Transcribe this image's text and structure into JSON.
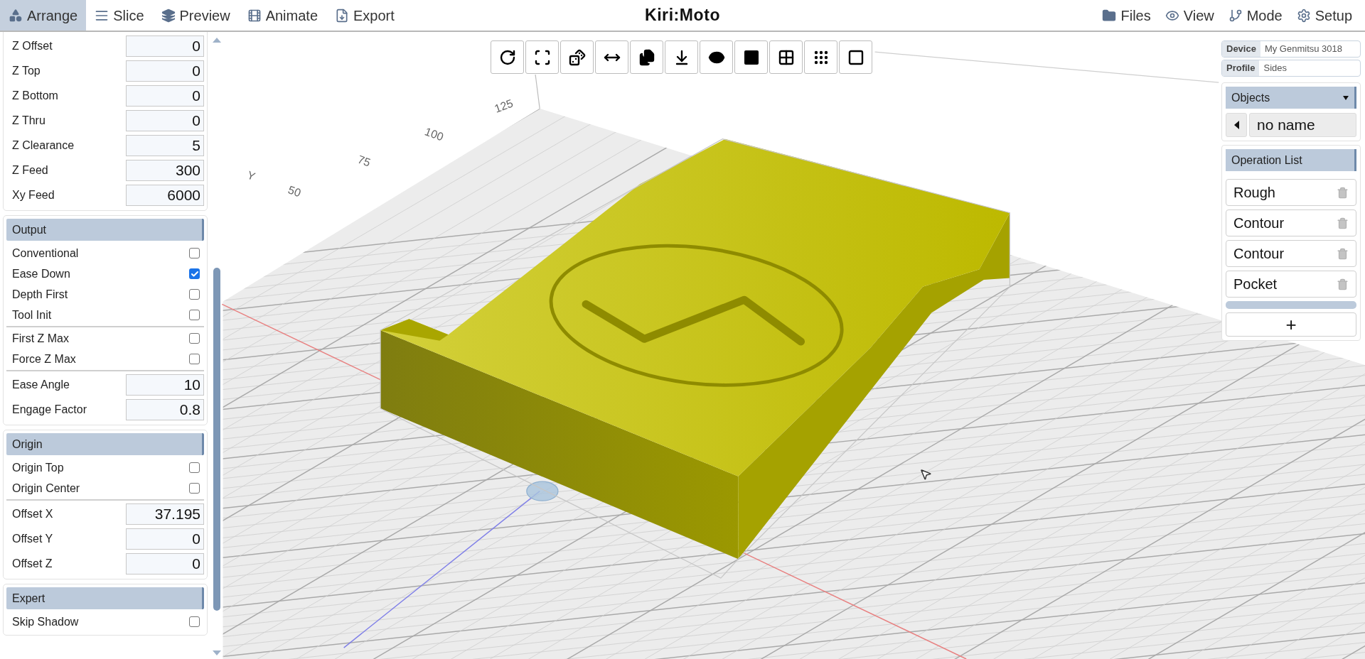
{
  "nav": {
    "tabs": [
      {
        "label": "Arrange",
        "kind": "arrange",
        "selected": true
      },
      {
        "label": "Slice",
        "kind": "slice",
        "selected": false
      },
      {
        "label": "Preview",
        "kind": "preview",
        "selected": false
      },
      {
        "label": "Animate",
        "kind": "animate",
        "selected": false
      },
      {
        "label": "Export",
        "kind": "export",
        "selected": false
      }
    ],
    "logo": "Kiri:Moto",
    "menu": [
      {
        "label": "Files",
        "kind": "files"
      },
      {
        "label": "View",
        "kind": "view"
      },
      {
        "label": "Mode",
        "kind": "mode"
      },
      {
        "label": "Setup",
        "kind": "setup"
      }
    ]
  },
  "settings": [
    {
      "rows": [
        {
          "kind": "number",
          "label": "Z Offset",
          "value": "0"
        },
        {
          "kind": "number",
          "label": "Z Top",
          "value": "0"
        },
        {
          "kind": "number",
          "label": "Z Bottom",
          "value": "0"
        },
        {
          "kind": "number",
          "label": "Z Thru",
          "value": "0"
        },
        {
          "kind": "number",
          "label": "Z Clearance",
          "value": "5"
        },
        {
          "kind": "number",
          "label": "Z Feed",
          "value": "300"
        },
        {
          "kind": "number",
          "label": "Xy Feed",
          "value": "6000"
        }
      ]
    },
    {
      "header": "Output",
      "rows": [
        {
          "kind": "checkbox",
          "label": "Conventional",
          "checked": false
        },
        {
          "kind": "checkbox",
          "label": "Ease Down",
          "checked": true
        },
        {
          "kind": "checkbox",
          "label": "Depth First",
          "checked": false
        },
        {
          "kind": "checkbox",
          "label": "Tool Init",
          "checked": false
        },
        {
          "kind": "divider"
        },
        {
          "kind": "checkbox",
          "label": "First Z Max",
          "checked": false
        },
        {
          "kind": "checkbox",
          "label": "Force Z Max",
          "checked": false
        },
        {
          "kind": "divider"
        },
        {
          "kind": "number",
          "label": "Ease Angle",
          "value": "10"
        },
        {
          "kind": "number",
          "label": "Engage Factor",
          "value": "0.8"
        }
      ]
    },
    {
      "header": "Origin",
      "rows": [
        {
          "kind": "checkbox",
          "label": "Origin Top",
          "checked": false
        },
        {
          "kind": "checkbox",
          "label": "Origin Center",
          "checked": false
        },
        {
          "kind": "divider"
        },
        {
          "kind": "number",
          "label": "Offset X",
          "value": "37.195"
        },
        {
          "kind": "number",
          "label": "Offset Y",
          "value": "0"
        },
        {
          "kind": "number",
          "label": "Offset Z",
          "value": "0"
        }
      ]
    },
    {
      "header": "Expert",
      "rows": [
        {
          "kind": "checkbox",
          "label": "Skip Shadow",
          "checked": false
        }
      ]
    }
  ],
  "axis_labels": [
    "125",
    "100",
    "75",
    "Y",
    "50"
  ],
  "info": [
    {
      "label": "Device",
      "value": "My Genmitsu 3018"
    },
    {
      "label": "Profile",
      "value": "Sides"
    }
  ],
  "objects": {
    "header": "Objects",
    "item": "no name"
  },
  "operations": {
    "header": "Operation List",
    "items": [
      "Rough",
      "Contour",
      "Contour",
      "Pocket"
    ],
    "add": "+"
  }
}
